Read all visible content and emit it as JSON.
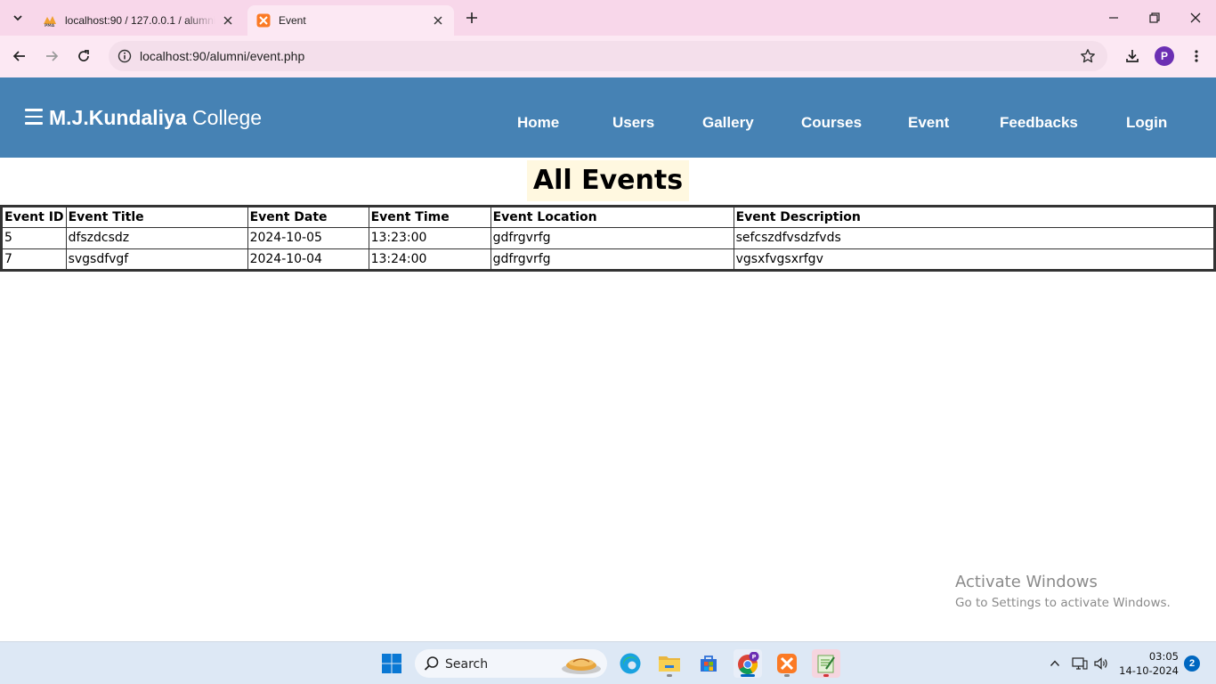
{
  "browser": {
    "tabs": [
      {
        "title": "localhost:90 / 127.0.0.1 / alumni",
        "favicon": "phpmyadmin-icon",
        "active": false
      },
      {
        "title": "Event",
        "favicon": "xampp-icon",
        "active": true
      }
    ],
    "url": "localhost:90/alumni/event.php",
    "profile_initial": "P"
  },
  "site": {
    "brand_bold": "M.J.Kundaliya",
    "brand_light": "College",
    "nav_color": "#4682b4",
    "menu": [
      "Home",
      "Users",
      "Gallery",
      "Courses",
      "Event",
      "Feedbacks",
      "Login"
    ]
  },
  "page": {
    "heading": "All Events",
    "table": {
      "headers": [
        "Event ID",
        "Event Title",
        "Event Date",
        "Event Time",
        "Event Location",
        "Event Description"
      ],
      "rows": [
        [
          "5",
          "dfszdcsdz",
          "2024-10-05",
          "13:23:00",
          "gdfrgvrfg",
          "sefcszdfvsdzfvds"
        ],
        [
          "7",
          "svgsdfvgf",
          "2024-10-04",
          "13:24:00",
          "gdfrgvrfg",
          "vgsxfvgsxrfgv"
        ]
      ]
    }
  },
  "watermark": {
    "line1": "Activate Windows",
    "line2": "Go to Settings to activate Windows."
  },
  "taskbar": {
    "search_label": "Search",
    "time": "03:05",
    "date": "14-10-2024",
    "notifications": "2"
  }
}
